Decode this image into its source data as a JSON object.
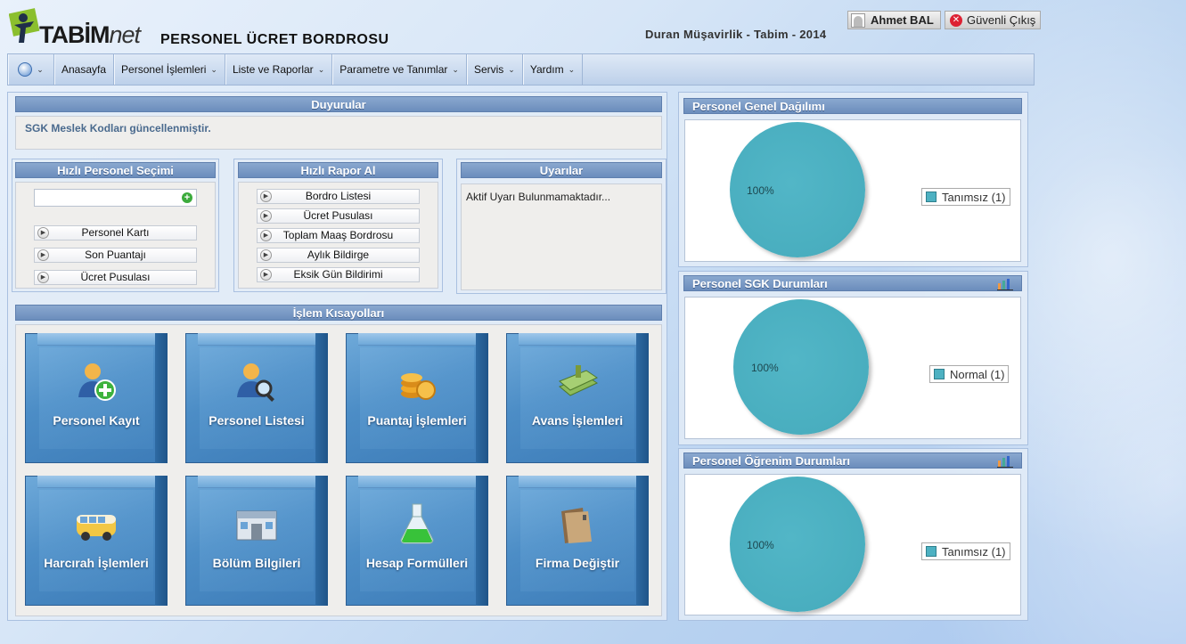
{
  "header": {
    "logo_main": "TABİM",
    "logo_suffix": "net",
    "app_title": "PERSONEL ÜCRET BORDROSU",
    "company": "Duran Müşavirlik - Tabim - 2014",
    "user_name": "Ahmet BAL",
    "logout_label": "Güvenli Çıkış"
  },
  "menu": {
    "items": [
      {
        "label": "Anasayfa"
      },
      {
        "label": "Personel İşlemleri"
      },
      {
        "label": "Liste ve Raporlar"
      },
      {
        "label": "Parametre ve Tanımlar"
      },
      {
        "label": "Servis"
      },
      {
        "label": "Yardım"
      }
    ]
  },
  "announcements": {
    "title": "Duyurular",
    "text": "SGK Meslek Kodları güncellenmiştir."
  },
  "quick_personnel": {
    "title": "Hızlı Personel Seçimi",
    "search_value": "",
    "buttons": [
      {
        "label": "Personel Kartı"
      },
      {
        "label": "Son Puantajı"
      },
      {
        "label": "Ücret Pusulası"
      }
    ]
  },
  "quick_report": {
    "title": "Hızlı Rapor Al",
    "buttons": [
      {
        "label": "Bordro Listesi"
      },
      {
        "label": "Ücret Pusulası"
      },
      {
        "label": "Toplam Maaş Bordrosu"
      },
      {
        "label": "Aylık Bildirge"
      },
      {
        "label": "Eksik Gün Bildirimi"
      }
    ]
  },
  "warnings": {
    "title": "Uyarılar",
    "text": "Aktif Uyarı Bulunmamaktadır..."
  },
  "shortcuts": {
    "title": "İşlem Kısayolları",
    "tiles": [
      {
        "label": "Personel Kayıt",
        "icon": "person-add-icon"
      },
      {
        "label": "Personel Listesi",
        "icon": "person-search-icon"
      },
      {
        "label": "Puantaj İşlemleri",
        "icon": "coins-icon"
      },
      {
        "label": "Avans İşlemleri",
        "icon": "money-icon"
      },
      {
        "label": "Harcırah İşlemleri",
        "icon": "van-icon"
      },
      {
        "label": "Bölüm Bilgileri",
        "icon": "building-icon"
      },
      {
        "label": "Hesap Formülleri",
        "icon": "flask-icon"
      },
      {
        "label": "Firma Değiştir",
        "icon": "folder-icon"
      }
    ]
  },
  "charts": [
    {
      "title": "Personel Genel Dağılımı",
      "slice_label": "100%",
      "legend": "Tanımsız (1)"
    },
    {
      "title": "Personel SGK Durumları",
      "slice_label": "100%",
      "legend": "Normal (1)"
    },
    {
      "title": "Personel Öğrenim Durumları",
      "slice_label": "100%",
      "legend": "Tanımsız (1)"
    }
  ],
  "chart_data": [
    {
      "type": "pie",
      "title": "Personel Genel Dağılımı",
      "categories": [
        "Tanımsız (1)"
      ],
      "values": [
        100
      ],
      "legend": "right"
    },
    {
      "type": "pie",
      "title": "Personel SGK Durumları",
      "categories": [
        "Normal (1)"
      ],
      "values": [
        100
      ],
      "legend": "right"
    },
    {
      "type": "pie",
      "title": "Personel Öğrenim Durumları",
      "categories": [
        "Tanımsız (1)"
      ],
      "values": [
        100
      ],
      "legend": "right"
    }
  ],
  "colors": {
    "accent": "#6b8dbc",
    "pie": "#4db1c2"
  }
}
